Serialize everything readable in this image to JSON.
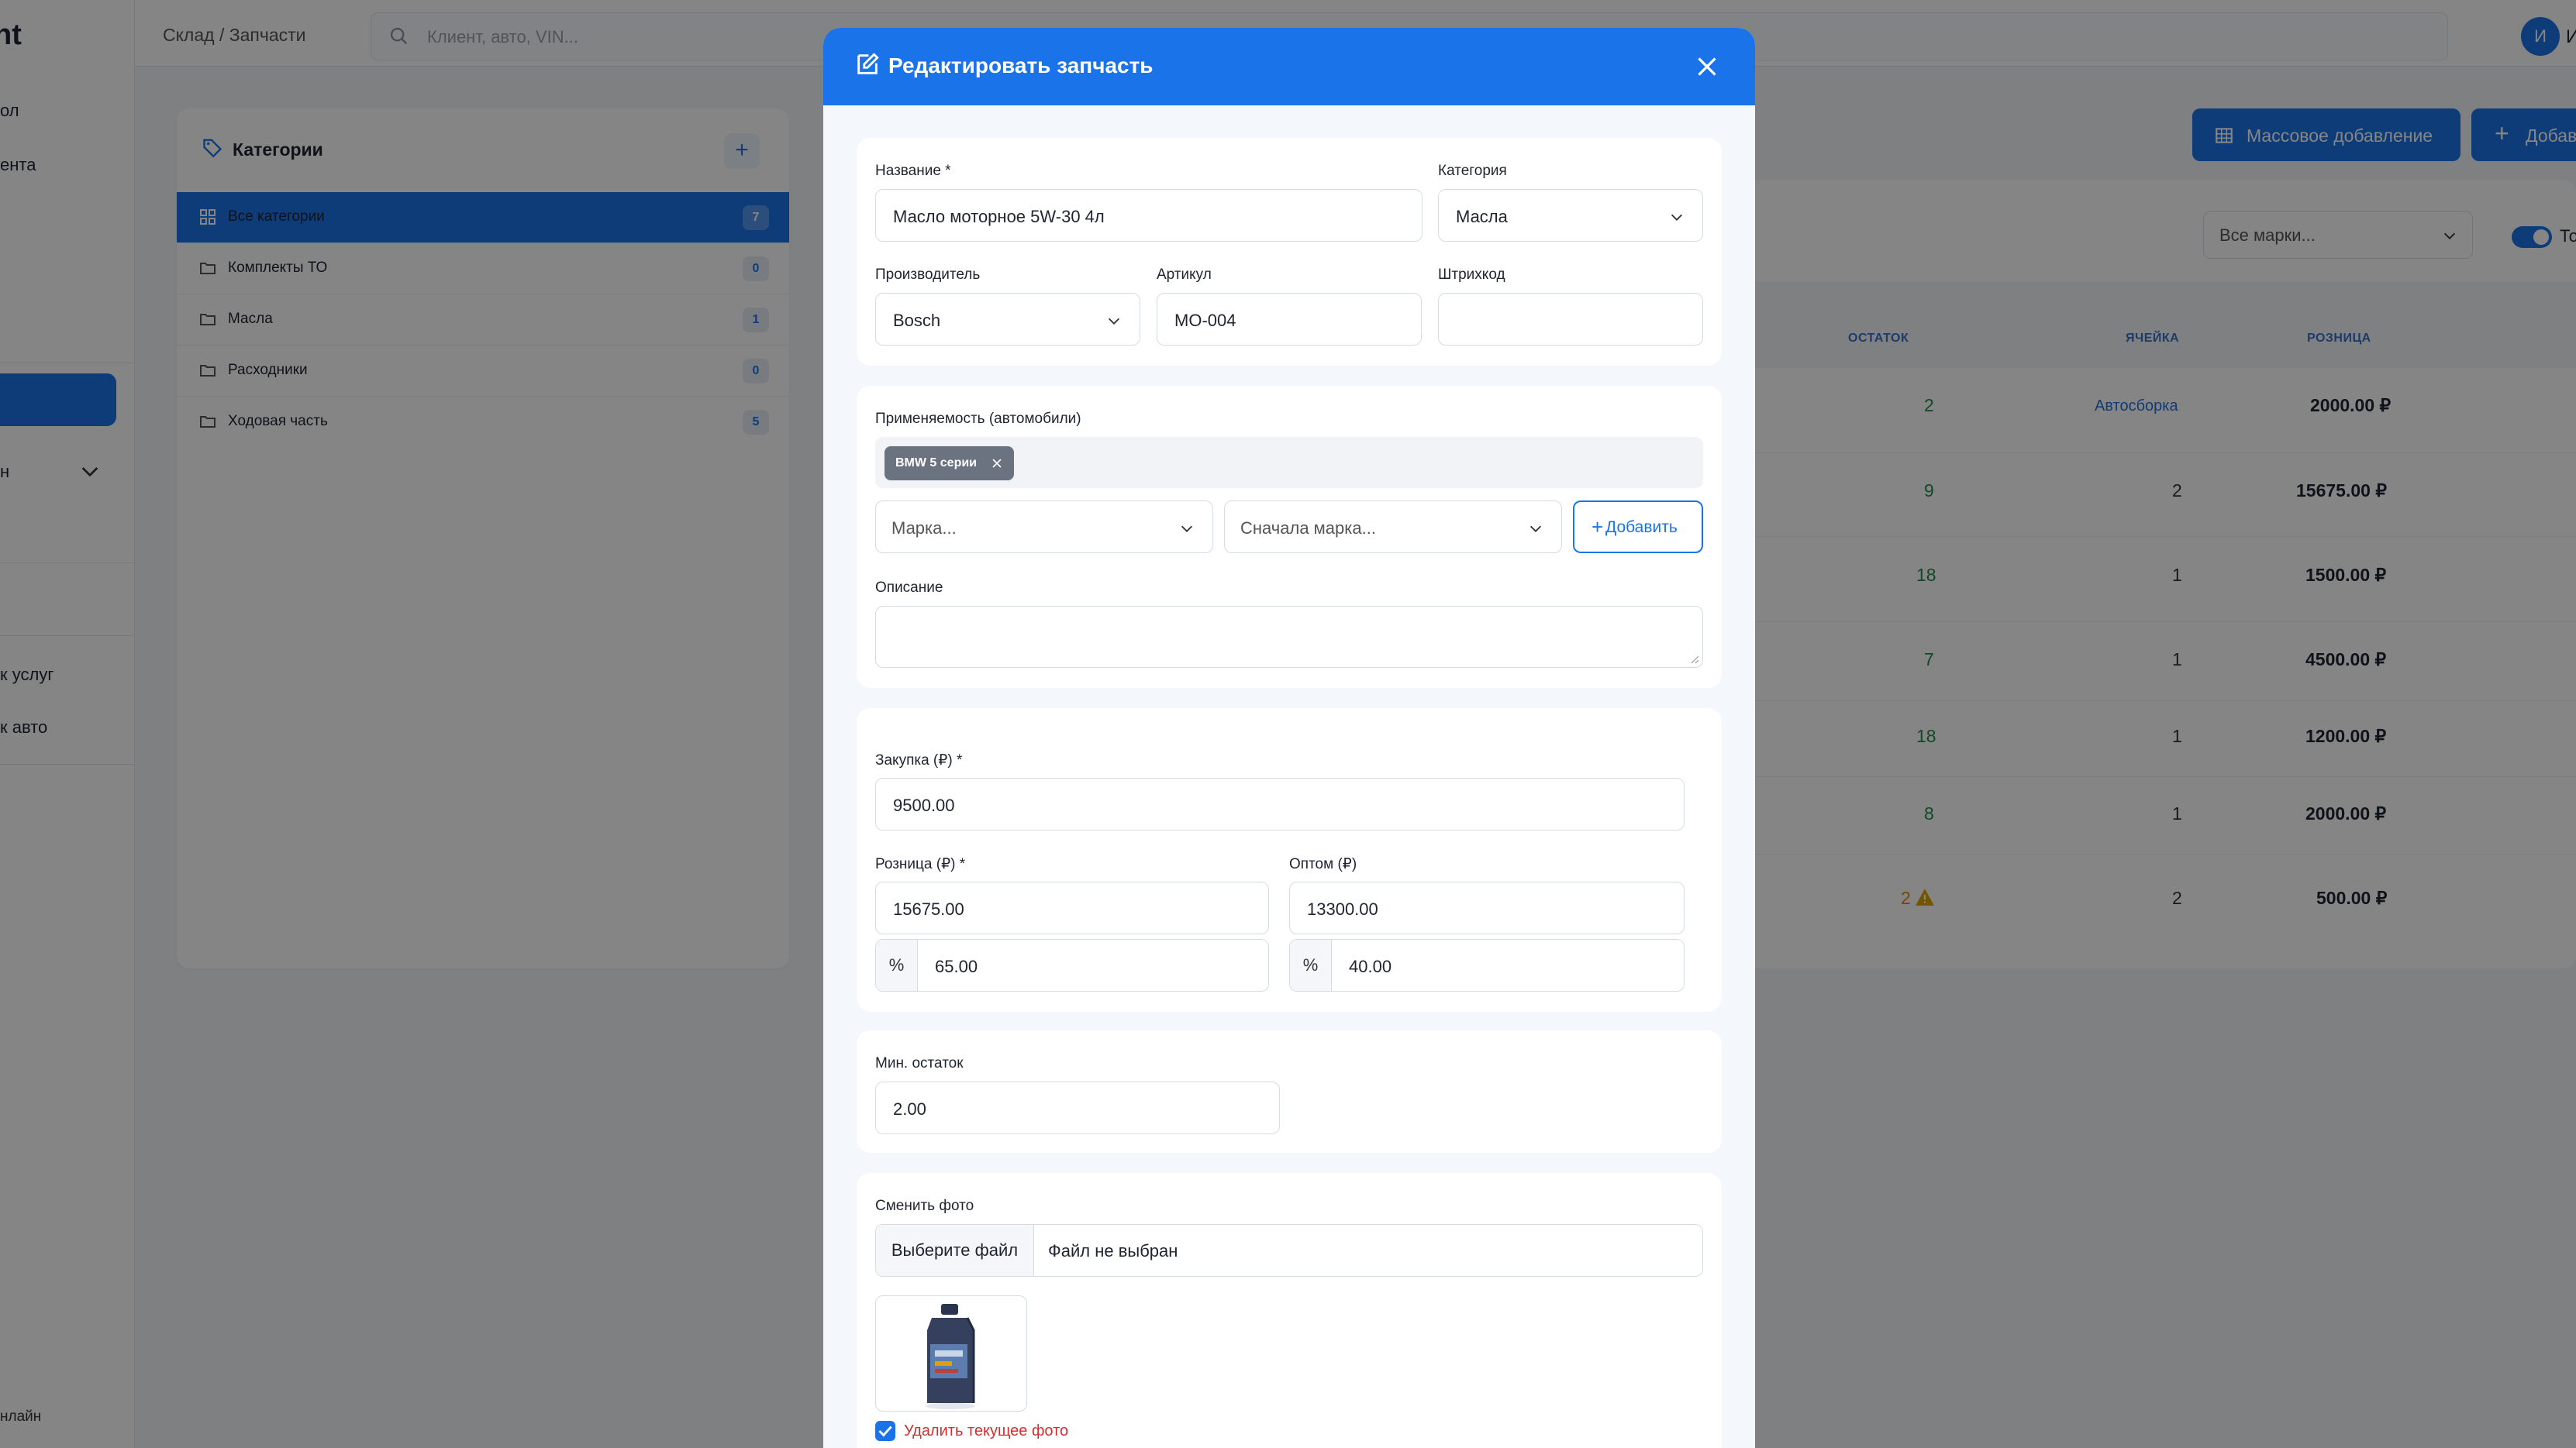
{
  "app": {
    "brand": "nt",
    "nav_items": [
      "ол",
      "ента",
      "н",
      "к услуг",
      "к авто"
    ],
    "status": "нлайн"
  },
  "topbar": {
    "breadcrumb": "Склад / Запчасти",
    "search_placeholder": "Клиент, авто, VIN...",
    "avatar_initial": "И",
    "avatar_name": "И"
  },
  "categories": {
    "title": "Категории",
    "add_label": "+",
    "items": [
      {
        "label": "Все категории",
        "count": "7"
      },
      {
        "label": "Комплекты ТО",
        "count": "0"
      },
      {
        "label": "Масла",
        "count": "1"
      },
      {
        "label": "Расходники",
        "count": "0"
      },
      {
        "label": "Ходовая часть",
        "count": "5"
      }
    ]
  },
  "toolbar": {
    "bulk_add_label": "Массовое добавление",
    "add_label": "Добав",
    "brand_filter_placeholder": "Все марки...",
    "toggle_label": "То"
  },
  "table": {
    "headers": {
      "stock": "ОСТАТОК",
      "bin": "ЯЧЕЙКА",
      "retail": "РОЗНИЦА"
    },
    "rows": [
      {
        "stock": "2",
        "bin": "Автосборка",
        "retail": "2000.00 ₽"
      },
      {
        "stock": "9",
        "bin": "2",
        "retail": "15675.00 ₽"
      },
      {
        "stock": "18",
        "bin": "1",
        "retail": "1500.00 ₽"
      },
      {
        "stock": "7",
        "bin": "1",
        "retail": "4500.00 ₽"
      },
      {
        "stock": "18",
        "bin": "1",
        "retail": "1200.00 ₽"
      },
      {
        "stock": "8",
        "bin": "1",
        "retail": "2000.00 ₽"
      },
      {
        "stock": "2",
        "bin": "2",
        "retail": "500.00 ₽"
      }
    ]
  },
  "modal": {
    "title": "Редактировать запчасть",
    "main": {
      "name_label": "Название *",
      "name_value": "Масло моторное 5W-30 4л",
      "category_label": "Категория",
      "category_value": "Масла",
      "manufacturer_label": "Производитель",
      "manufacturer_value": "Bosch",
      "sku_label": "Артикул",
      "sku_value": "МО-004",
      "barcode_label": "Штрихкод",
      "barcode_value": ""
    },
    "applicability": {
      "label": "Применяемость (автомобили)",
      "chips": [
        "BMW 5 серии"
      ],
      "make_placeholder": "Марка...",
      "model_placeholder": "Сначала марка...",
      "add_button": "Добавить",
      "description_label": "Описание",
      "description_value": ""
    },
    "prices": {
      "purchase_label": "Закупка (₽) *",
      "purchase_value": "9500.00",
      "retail_label": "Розница (₽) *",
      "retail_value": "15675.00",
      "retail_percent": "65.00",
      "wholesale_label": "Оптом (₽)",
      "wholesale_value": "13300.00",
      "wholesale_percent": "40.00",
      "percent_symbol": "%"
    },
    "stock": {
      "min_label": "Мин. остаток",
      "min_value": "2.00"
    },
    "photo": {
      "label": "Сменить фото",
      "choose_button": "Выберите файл",
      "file_status": "Файл не выбран",
      "delete_label": "Удалить текущее фото",
      "delete_checked": true
    }
  },
  "colors": {
    "accent": "#1a73e8",
    "stock_ok": "#1f8a4c",
    "warning": "#d98c00",
    "danger": "#d32f2f"
  }
}
